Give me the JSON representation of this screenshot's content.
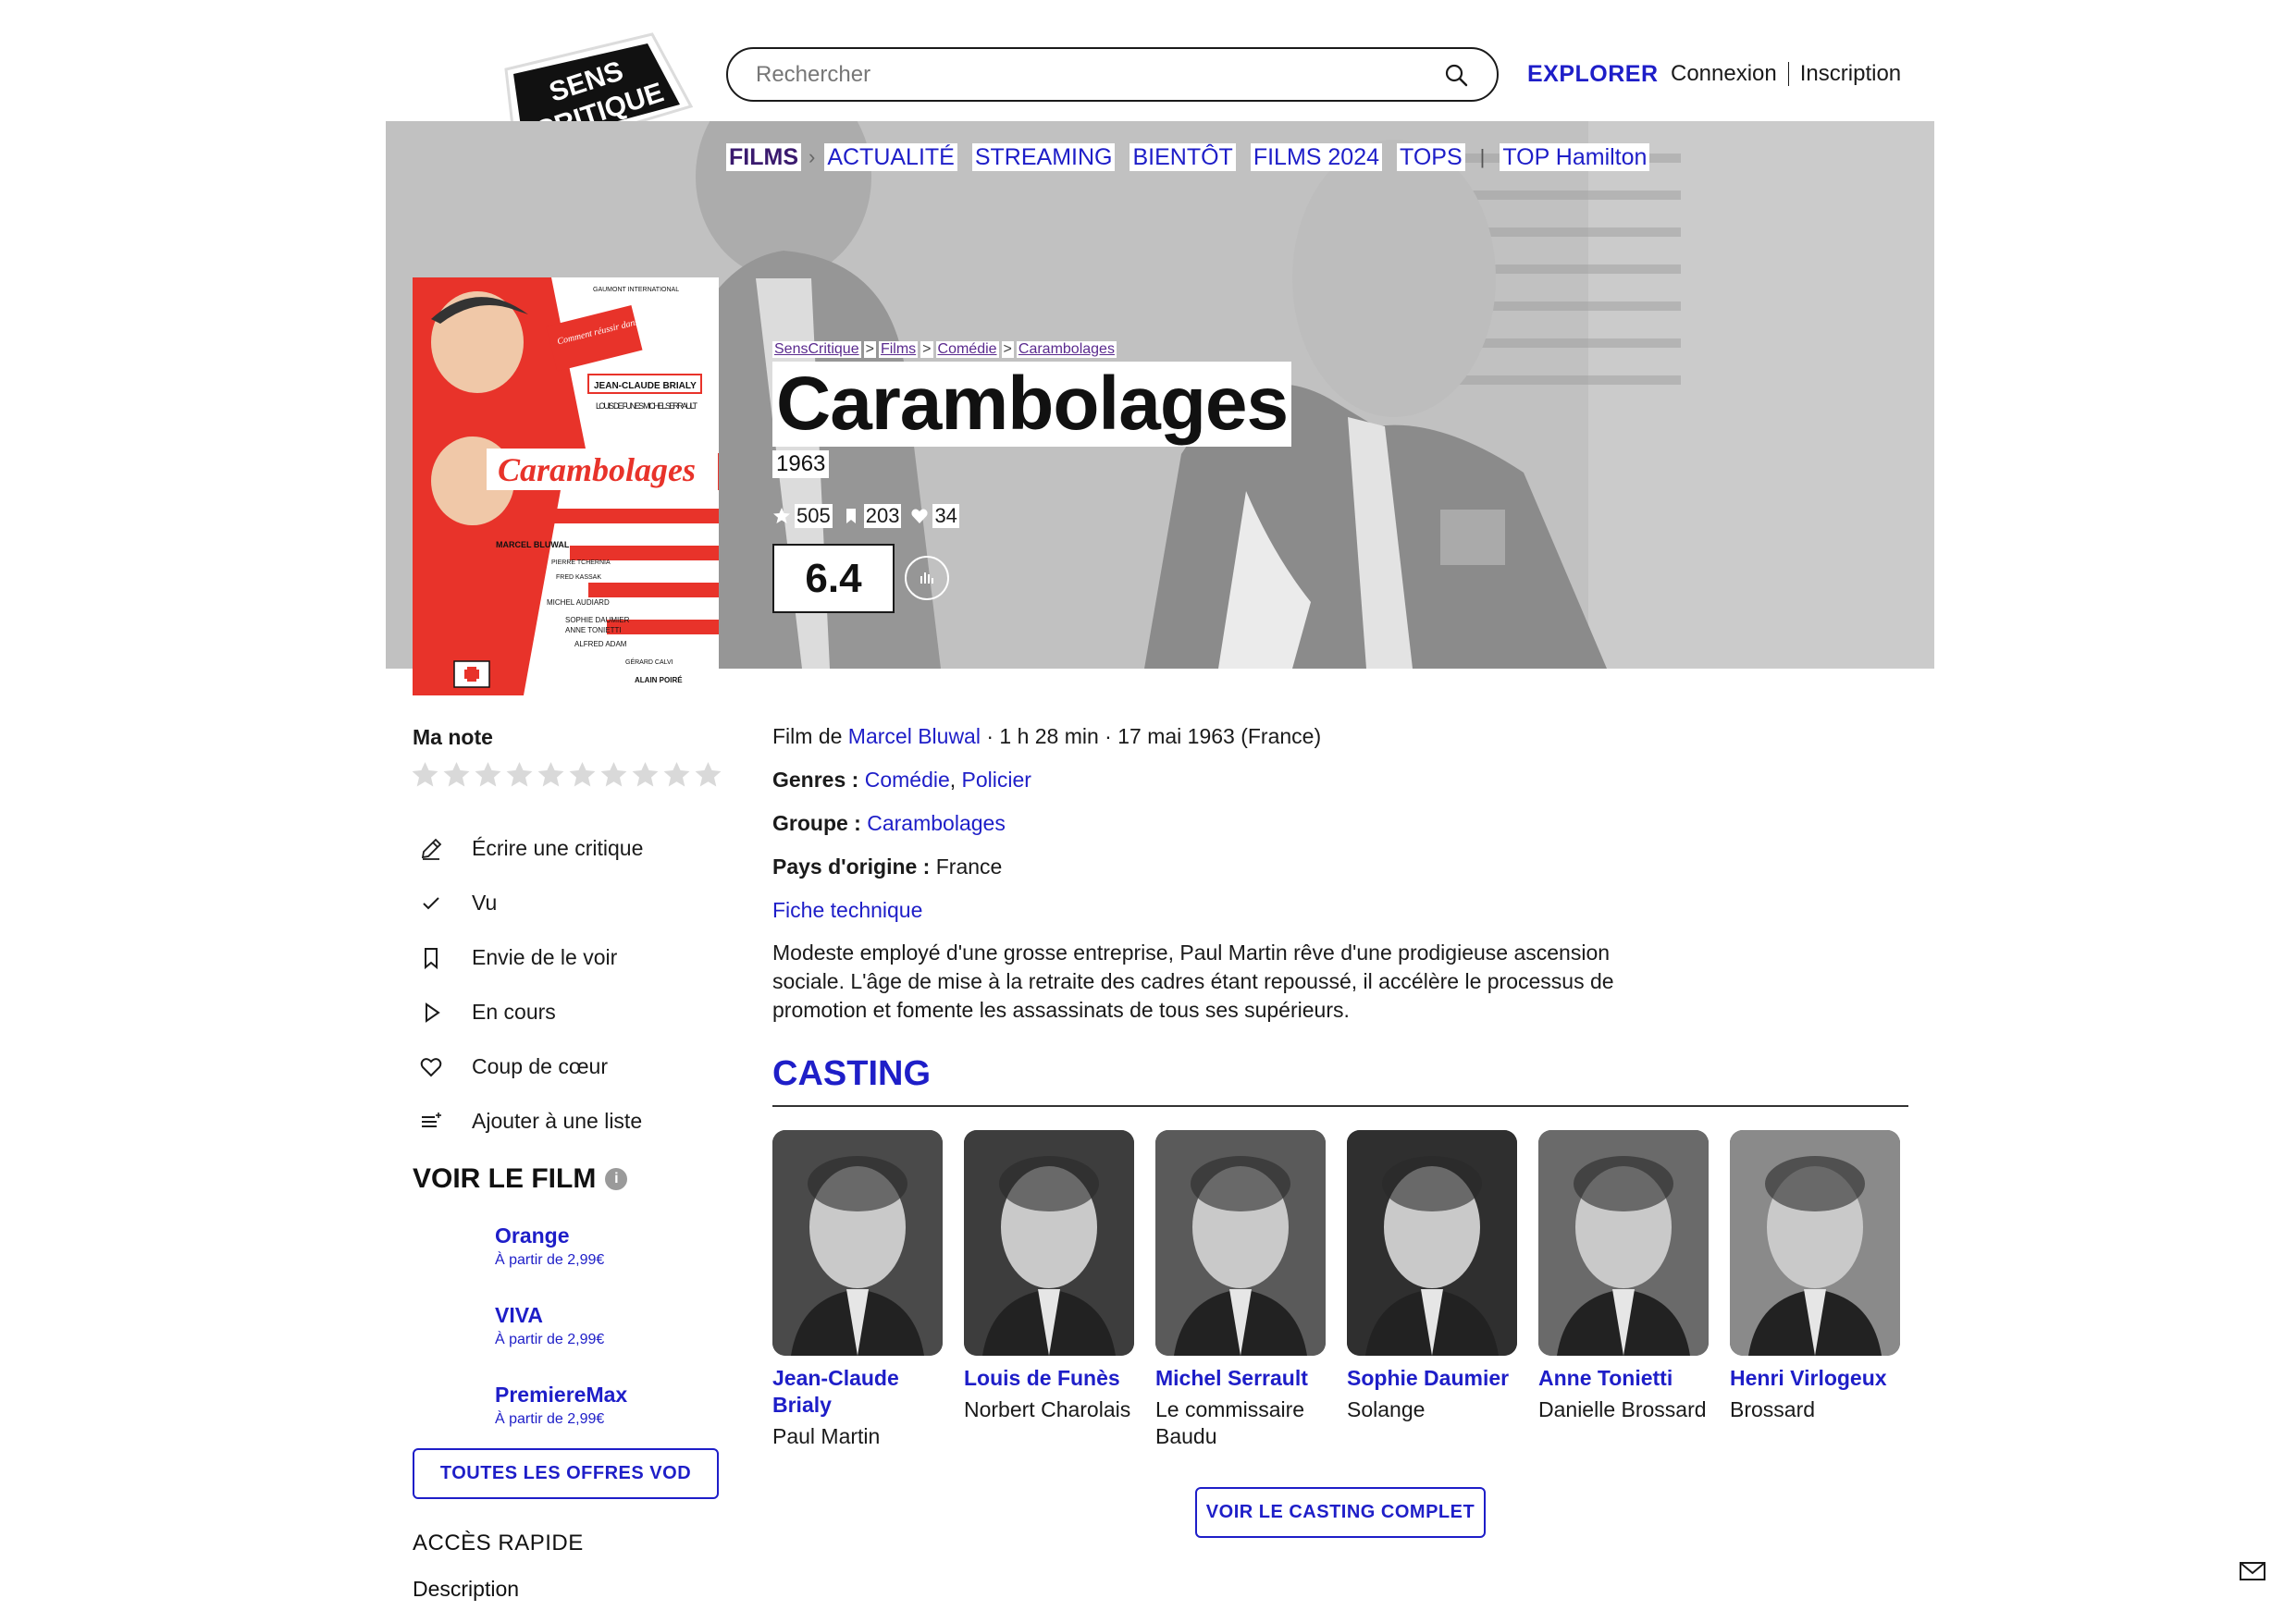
{
  "header": {
    "logo_text_top": "SENS",
    "logo_text_bottom": "CRITIQUE",
    "search_placeholder": "Rechercher",
    "explorer_label": "EXPLORER",
    "login_label": "Connexion",
    "signup_label": "Inscription"
  },
  "nav": {
    "items": [
      "FILMS",
      "ACTUALITÉ",
      "STREAMING",
      "BIENTÔT",
      "FILMS 2024",
      "TOPS",
      "TOP Hamilton"
    ]
  },
  "breadcrumb": [
    "SensCritique",
    "Films",
    "Comédie",
    "Carambolages"
  ],
  "film": {
    "title": "Carambolages",
    "year": "1963",
    "stats": {
      "ratings": "505",
      "wishlist": "203",
      "favorites": "34"
    },
    "average_rating": "6.4",
    "director_prefix": "Film de",
    "director": "Marcel Bluwal",
    "details": " · 1 h 28 min · 17 mai 1963 (France)",
    "genres_label": "Genres :",
    "genres": [
      "Comédie",
      "Policier"
    ],
    "group_label": "Groupe :",
    "group": "Carambolages",
    "country_label": "Pays d'origine :",
    "country": "France",
    "fiche_label": "Fiche technique",
    "synopsis": "Modeste employé d'une grosse entreprise, Paul Martin rêve d'une prodigieuse ascension sociale. L'âge de mise à la retraite des cadres étant repoussé, il accélère le processus de promotion et fomente les assassinats de tous ses supérieurs."
  },
  "poster": {
    "studio": "GAUMONT INTERNATIONAL",
    "tagline": "Comment réussir dans la Vie...",
    "star": "JEAN-CLAUDE BRIALY",
    "costars": "LOUIS DE FUNES MICHEL SERRAULT",
    "title": "Carambolages",
    "director_credit": "MARCEL BLUWAL",
    "credits": [
      "PIERRE TCHERNIA",
      "FRED KASSAK",
      "MICHEL AUDIARD",
      "SOPHIE DAUMIER",
      "ANNE TONIETTI",
      "ALFRED ADAM",
      "GÉRARD CALVI",
      "ALAIN POIRÉ"
    ]
  },
  "sidebar": {
    "my_rating_label": "Ma note",
    "star_count": 10,
    "actions": [
      {
        "label": "Écrire une critique",
        "icon": "pencil-icon"
      },
      {
        "label": "Vu",
        "icon": "check-icon"
      },
      {
        "label": "Envie de le voir",
        "icon": "bookmark-icon"
      },
      {
        "label": "En cours",
        "icon": "play-icon"
      },
      {
        "label": "Coup de cœur",
        "icon": "heart-icon"
      },
      {
        "label": "Ajouter à une liste",
        "icon": "list-add-icon"
      }
    ],
    "watch_title": "VOIR LE FILM",
    "offers": [
      {
        "name": "Orange",
        "price": "À partir de 2,99€"
      },
      {
        "name": "VIVA",
        "price": "À partir de 2,99€"
      },
      {
        "name": "PremiereMax",
        "price": "À partir de 2,99€"
      }
    ],
    "vod_button": "TOUTES LES OFFRES VOD",
    "quick_access_title": "ACCÈS RAPIDE",
    "quick_access_first": "Description"
  },
  "casting": {
    "title": "CASTING",
    "members": [
      {
        "actor": "Jean-Claude Brialy",
        "role": "Paul Martin"
      },
      {
        "actor": "Louis de Funès",
        "role": "Norbert Charolais"
      },
      {
        "actor": "Michel Serrault",
        "role": "Le commissaire Baudu"
      },
      {
        "actor": "Sophie Daumier",
        "role": "Solange"
      },
      {
        "actor": "Anne Tonietti",
        "role": "Danielle Brossard"
      },
      {
        "actor": "Henri Virlogeux",
        "role": "Brossard"
      }
    ],
    "full_button": "VOIR LE CASTING COMPLET"
  },
  "colors": {
    "accent": "#1E1EC8",
    "poster_red": "#E8332A",
    "breadcrumb_purple": "#5a2a8e"
  }
}
